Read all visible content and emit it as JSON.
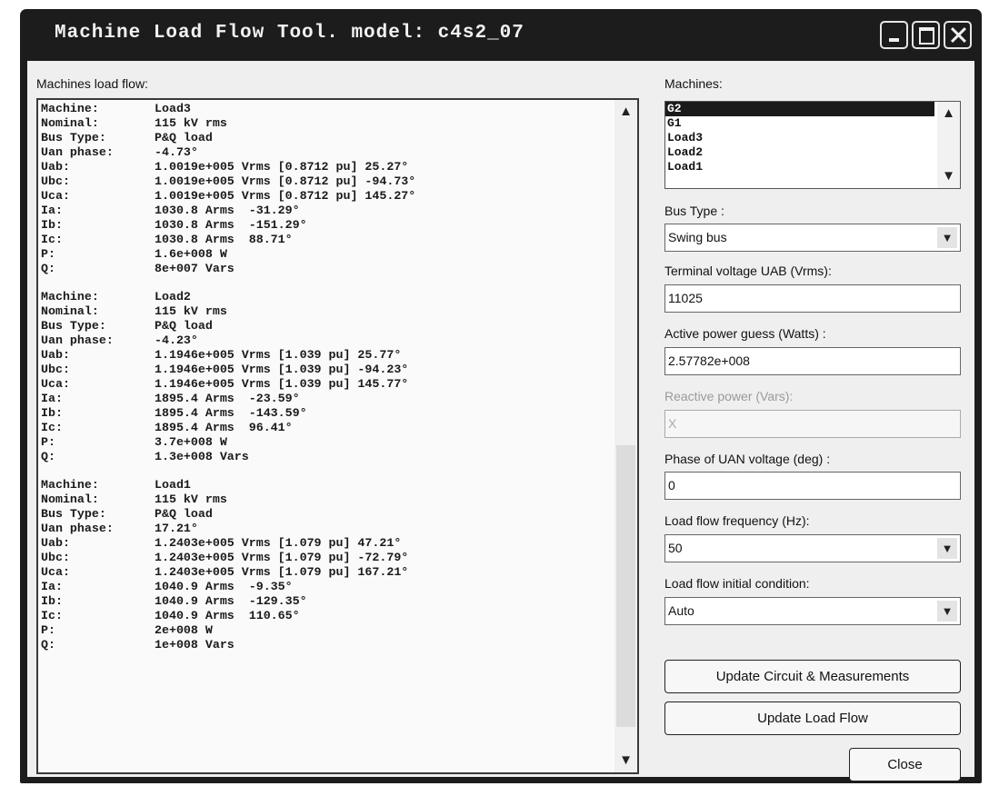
{
  "window": {
    "title": "Machine Load Flow Tool. model: c4s2_07"
  },
  "load_flow": {
    "label": "Machines load flow:",
    "machines": [
      {
        "rows": [
          [
            "Machine:",
            "Load3"
          ],
          [
            "Nominal:",
            "115 kV rms"
          ],
          [
            "Bus Type:",
            "P&Q load"
          ],
          [
            "Uan phase:",
            "-4.73°"
          ],
          [
            "Uab:",
            "1.0019e+005 Vrms [0.8712 pu] 25.27°"
          ],
          [
            "Ubc:",
            "1.0019e+005 Vrms [0.8712 pu] -94.73°"
          ],
          [
            "Uca:",
            "1.0019e+005 Vrms [0.8712 pu] 145.27°"
          ],
          [
            "Ia:",
            "1030.8 Arms  -31.29°"
          ],
          [
            "Ib:",
            "1030.8 Arms  -151.29°"
          ],
          [
            "Ic:",
            "1030.8 Arms  88.71°"
          ],
          [
            "P:",
            "1.6e+008 W"
          ],
          [
            "Q:",
            "8e+007 Vars"
          ]
        ]
      },
      {
        "rows": [
          [
            "Machine:",
            "Load2"
          ],
          [
            "Nominal:",
            "115 kV rms"
          ],
          [
            "Bus Type:",
            "P&Q load"
          ],
          [
            "Uan phase:",
            "-4.23°"
          ],
          [
            "Uab:",
            "1.1946e+005 Vrms [1.039 pu] 25.77°"
          ],
          [
            "Ubc:",
            "1.1946e+005 Vrms [1.039 pu] -94.23°"
          ],
          [
            "Uca:",
            "1.1946e+005 Vrms [1.039 pu] 145.77°"
          ],
          [
            "Ia:",
            "1895.4 Arms  -23.59°"
          ],
          [
            "Ib:",
            "1895.4 Arms  -143.59°"
          ],
          [
            "Ic:",
            "1895.4 Arms  96.41°"
          ],
          [
            "P:",
            "3.7e+008 W"
          ],
          [
            "Q:",
            "1.3e+008 Vars"
          ]
        ]
      },
      {
        "rows": [
          [
            "Machine:",
            "Load1"
          ],
          [
            "Nominal:",
            "115 kV rms"
          ],
          [
            "Bus Type:",
            "P&Q load"
          ],
          [
            "Uan phase:",
            "17.21°"
          ],
          [
            "Uab:",
            "1.2403e+005 Vrms [1.079 pu] 47.21°"
          ],
          [
            "Ubc:",
            "1.2403e+005 Vrms [1.079 pu] -72.79°"
          ],
          [
            "Uca:",
            "1.2403e+005 Vrms [1.079 pu] 167.21°"
          ],
          [
            "Ia:",
            "1040.9 Arms  -9.35°"
          ],
          [
            "Ib:",
            "1040.9 Arms  -129.35°"
          ],
          [
            "Ic:",
            "1040.9 Arms  110.65°"
          ],
          [
            "P:",
            "2e+008 W"
          ],
          [
            "Q:",
            "1e+008 Vars"
          ]
        ]
      }
    ]
  },
  "machines_list": {
    "label": "Machines:",
    "items": [
      "G2",
      "G1",
      "Load3",
      "Load2",
      "Load1"
    ],
    "selected": "G2"
  },
  "bus_type": {
    "label": "Bus Type :",
    "value": "Swing bus"
  },
  "terminal_voltage": {
    "label": "Terminal voltage UAB (Vrms):",
    "value": "11025"
  },
  "active_power": {
    "label": "Active power guess (Watts) :",
    "value": "2.57782e+008"
  },
  "reactive_power": {
    "label": "Reactive power (Vars):",
    "value": "X"
  },
  "phase_uan": {
    "label": "Phase of UAN voltage (deg) :",
    "value": "0"
  },
  "frequency": {
    "label": "Load flow frequency (Hz):",
    "value": "50"
  },
  "initial_condition": {
    "label": "Load flow initial condition:",
    "value": "Auto"
  },
  "buttons": {
    "update_circuit": "Update Circuit & Measurements",
    "update_load_flow": "Update Load Flow",
    "close": "Close"
  }
}
